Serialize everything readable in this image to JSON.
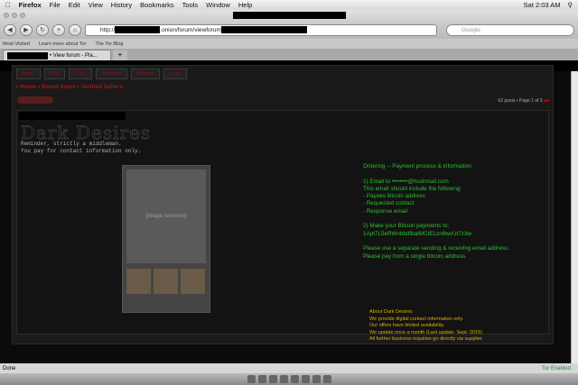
{
  "menubar": {
    "app": "Firefox",
    "items": [
      "File",
      "Edit",
      "View",
      "History",
      "Bookmarks",
      "Tools",
      "Window",
      "Help"
    ],
    "clock": "Sat 2:03 AM"
  },
  "toolbar": {
    "url_prefix": "http://",
    "url_mid": ".onion/forum/viewforum",
    "search_placeholder": "Google"
  },
  "bookmarks": [
    "Most Visited",
    "Learn more about Tor",
    "The Tor Blog"
  ],
  "tab": {
    "label": "• View forum - Pla..."
  },
  "nav": [
    "Home",
    "FAQ",
    "Rules",
    "Members",
    "Register",
    "Login"
  ],
  "breadcrumb": "• Home • Board index • Verified Sellers",
  "pager": {
    "posts": "62 posts •",
    "page": "Page 1 of 3"
  },
  "post": {
    "title": "Dark Desires",
    "notice1": "Reminder, strictly a middleman.",
    "notice2": "You pay for contact information only.",
    "photo_placeholder": "[image removed]"
  },
  "payment": {
    "heading": "Ordering -- Payment process & information:",
    "step1": "1) Email to ••••••••@hushmail.com",
    "step1b": "This email should include the following:",
    "items": [
      "- Payees bitcoin address",
      "- Requested contact",
      "- Response email"
    ],
    "step2": "2) Make your Bitcoin payments to:",
    "address": "1Apt7L5eRWnbbdfbatMCtELcn8wvUt7z3w",
    "note1": "Please use a separate sending & receiving email address.",
    "note2": "Please pay from a single bitcoin address."
  },
  "about": {
    "heading": "About Dark Desires",
    "lines": [
      "We provide digital contact information only.",
      "Our offers have limited availability.",
      "We update once a month (Last update: Sept. 2015)",
      "All further business inquiries go directly via supplier."
    ]
  },
  "status": {
    "left": "Done",
    "right": "Tor Enabled"
  }
}
